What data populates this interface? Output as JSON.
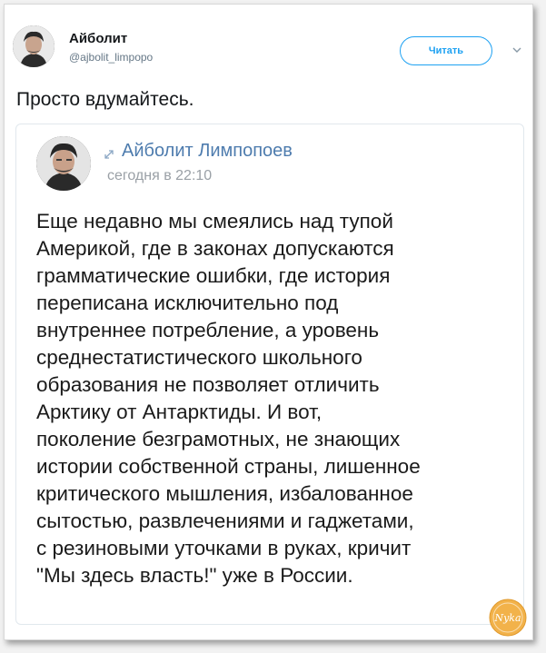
{
  "header": {
    "name": "Айболит",
    "handle": "@ajbolit_limpopo",
    "follow_label": "Читать"
  },
  "tweet": {
    "text": "Просто вдумайтесь."
  },
  "embedded_post": {
    "author": "Айболит Лимпопоев",
    "time": "сегодня в 22:10",
    "body": "Еще недавно мы смеялись над тупой\nАмерикой, где в законах допускаются\nграмматические ошибки, где история\nпереписана исключительно под\nвнутреннее потребление, а уровень\nсреднестатистического школьного\nобразования не позволяет отличить\nАрктику от Антарктиды. И вот,\nпоколение безграмотных, не знающих\nистории собственной страны, лишенное\nкритического мышления, избалованное\nсытостью, развлечениями и гаджетами,\nс резиновыми уточками в руках, кричит\n\"Мы здесь власть!\" уже в России."
  },
  "watermark": {
    "text": "Nyka"
  },
  "colors": {
    "accent": "#1da1f2",
    "author_link": "#4e7cae",
    "badge": "#f2b24a"
  },
  "icons": {
    "avatar": "portrait-avatar",
    "chevron": "chevron-down-icon",
    "repost": "repost-icon"
  }
}
